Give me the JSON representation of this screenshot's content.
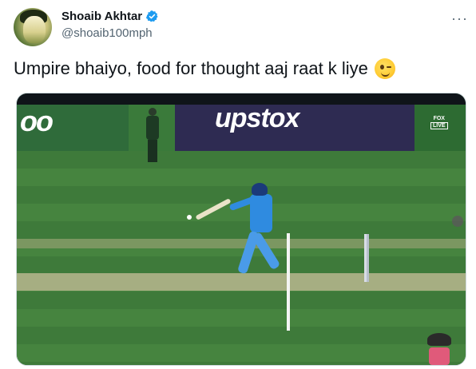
{
  "author": {
    "name": "Shoaib Akhtar",
    "handle": "@shoaib100mph",
    "verified_icon": "verified-badge-icon",
    "avatar": "profile-avatar"
  },
  "more_menu": {
    "label": "···",
    "icon": "more-dots-icon"
  },
  "tweet": {
    "text": "Umpire bhaiyo, food for thought aaj raat k liye",
    "emoji": "winking-face-icon"
  },
  "media": {
    "board_left_text": "oo",
    "board_right_text": "upstox",
    "broadcaster": "FOX",
    "broadcaster_tag": "LIVE",
    "colors": {
      "accent_blue": "#1d9bf0",
      "board_purple": "#2e2b52",
      "field_green": "#3e7a3a"
    }
  }
}
